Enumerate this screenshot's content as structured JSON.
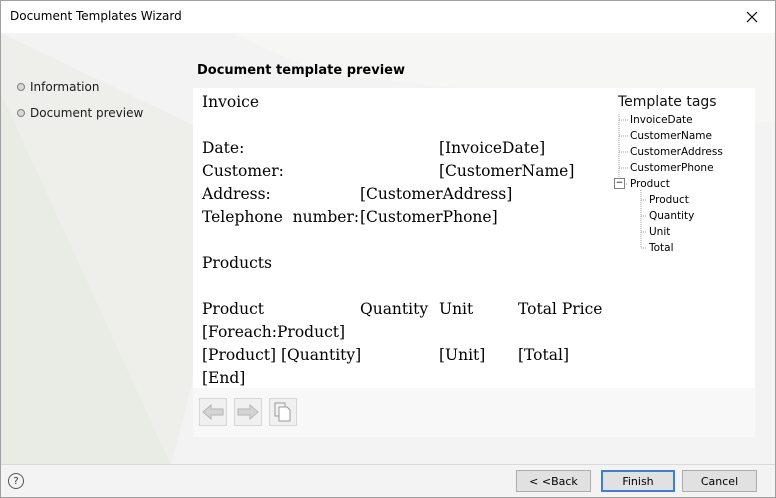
{
  "window": {
    "title": "Document Templates Wizard"
  },
  "nav": {
    "items": [
      "Information",
      "Document preview"
    ]
  },
  "section_title": "Document template preview",
  "preview": {
    "heading": "Invoice",
    "fields": [
      {
        "label": "Date:",
        "tag": "[InvoiceDate]"
      },
      {
        "label": "Customer:",
        "tag": "[CustomerName]"
      },
      {
        "label": "Address:",
        "tag": "[CustomerAddress]"
      },
      {
        "label": "Telephone  number:",
        "tag": "[CustomerPhone]"
      }
    ],
    "products_heading": "Products",
    "columns": [
      "Product",
      "Quantity",
      "Unit",
      "Total Price"
    ],
    "foreach": "[Foreach:Product]",
    "row": [
      "[Product]",
      "[Quantity]",
      "[Unit]",
      "[Total]"
    ],
    "end": "[End]"
  },
  "tags": {
    "title": "Template tags",
    "items": [
      "InvoiceDate",
      "CustomerName",
      "CustomerAddress",
      "CustomerPhone"
    ],
    "group": {
      "label": "Product",
      "expand_symbol": "−",
      "children": [
        "Product",
        "Quantity",
        "Unit",
        "Total"
      ]
    }
  },
  "toolbar": {
    "icons": [
      "arrow-left-icon",
      "arrow-right-icon",
      "copy-icon"
    ]
  },
  "footer": {
    "help": "?",
    "back": "< <Back",
    "finish": "Finish",
    "cancel": "Cancel"
  },
  "colors": {
    "accent": "#3c7fd6"
  }
}
